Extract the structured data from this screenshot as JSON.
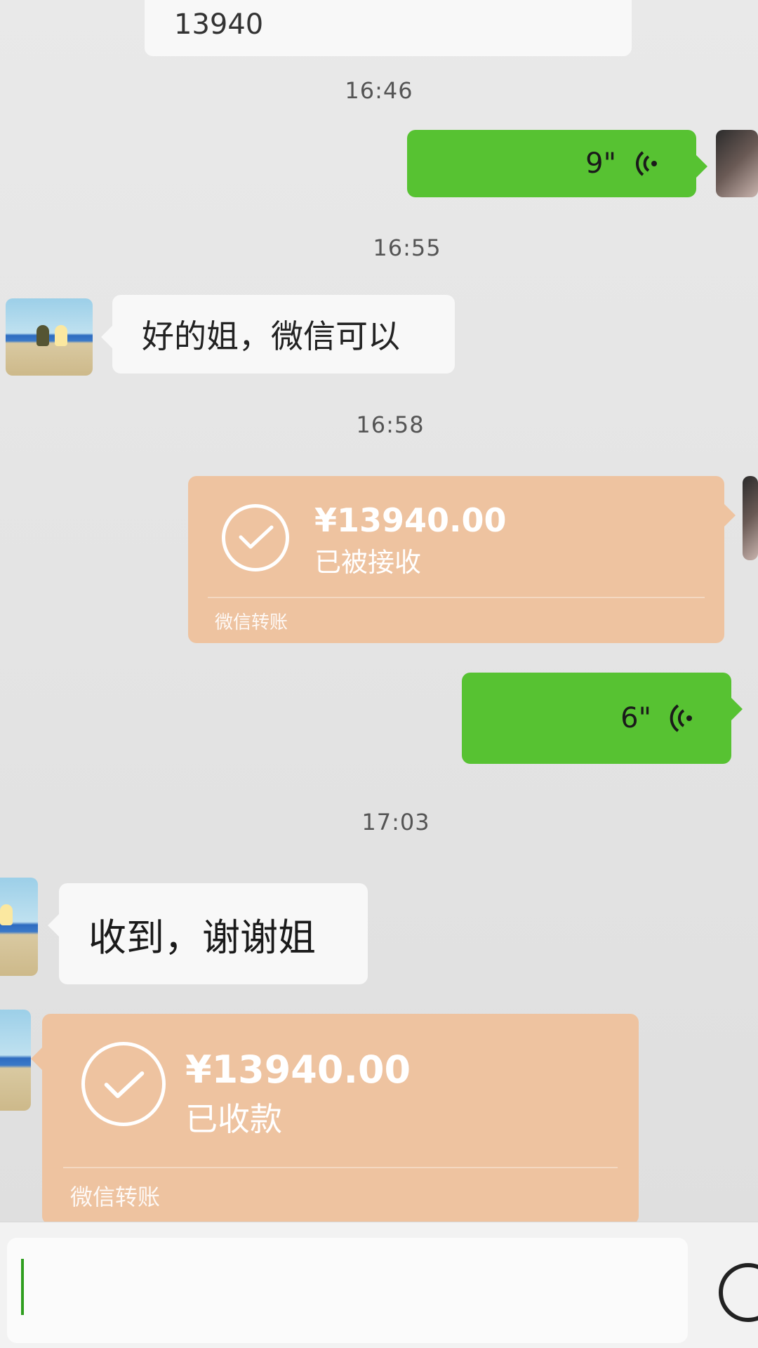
{
  "top_partial_message": {
    "text": "13940"
  },
  "timestamps": [
    "16:46",
    "16:55",
    "16:58",
    "17:03"
  ],
  "messages": {
    "voice1": {
      "duration": "9\""
    },
    "reply1": {
      "text": "好的姐，微信可以"
    },
    "transfer_sent": {
      "amount": "¥13940.00",
      "status": "已被接收",
      "footer": "微信转账"
    },
    "voice2": {
      "duration": "6\""
    },
    "reply2": {
      "text": "收到，谢谢姐"
    },
    "transfer_received": {
      "amount": "¥13940.00",
      "status": "已收款",
      "footer": "微信转账"
    }
  },
  "input_bar": {
    "placeholder": ""
  },
  "colors": {
    "green_bubble": "#57c232",
    "transfer_bubble": "#eec3a0",
    "white_bubble": "#f8f8f8",
    "background": "#e6e6e6"
  },
  "icons": [
    "voice-wave-icon",
    "check-circle-icon",
    "emoji-icon"
  ]
}
